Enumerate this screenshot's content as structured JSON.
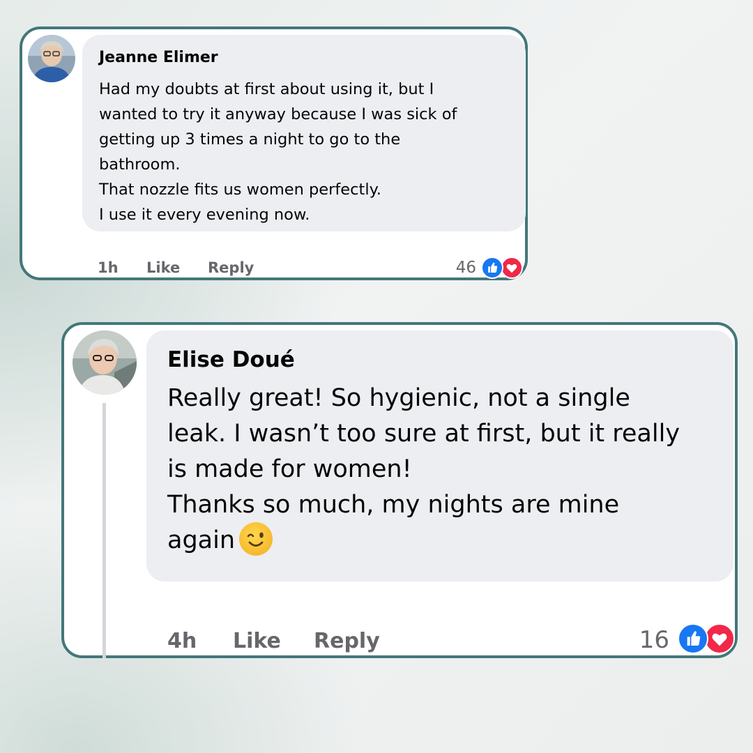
{
  "comments": [
    {
      "author": "Jeanne Elimer",
      "lines": [
        "Had my doubts at first about using it, but I",
        "wanted to try it anyway because I was sick of",
        "getting up 3 times a night to go to the",
        "bathroom.",
        "That nozzle fits us women perfectly.",
        "I use it every evening now."
      ],
      "time": "1h",
      "like_label": "Like",
      "reply_label": "Reply",
      "reaction_count": "46",
      "reactions": [
        "like-icon",
        "love-icon"
      ]
    },
    {
      "author": "Elise Doué",
      "lines": [
        "Really great! So hygienic, not a single",
        "leak. I wasn’t too sure at first, but it really",
        "is made for women!",
        "Thanks so much, my nights are mine",
        "again"
      ],
      "emoji": "winking-smile-emoji",
      "time": "4h",
      "like_label": "Like",
      "reply_label": "Reply",
      "reaction_count": "16",
      "reactions": [
        "like-icon",
        "love-icon"
      ]
    }
  ],
  "colors": {
    "card_border": "#43777a",
    "bubble": "#eceef1",
    "meta_text": "#65676b",
    "like_blue": "#1877f2",
    "love_red": "#f02849"
  }
}
